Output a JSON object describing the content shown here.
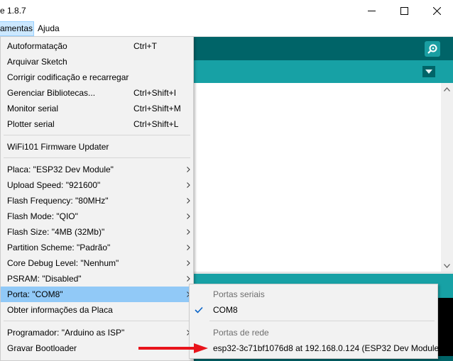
{
  "window": {
    "title": "e 1.8.7",
    "controls": [
      "minimize-icon",
      "maximize-icon",
      "close-icon"
    ]
  },
  "menubar": {
    "items": [
      {
        "label": "amentas",
        "active": true
      },
      {
        "label": "Ajuda",
        "active": false
      }
    ]
  },
  "tools_menu": {
    "items": [
      {
        "label": "Autoformatação",
        "shortcut": "Ctrl+T"
      },
      {
        "label": "Arquivar Sketch",
        "shortcut": ""
      },
      {
        "label": "Corrigir codificação e recarregar",
        "shortcut": ""
      },
      {
        "label": "Gerenciar Bibliotecas...",
        "shortcut": "Ctrl+Shift+I"
      },
      {
        "label": "Monitor serial",
        "shortcut": "Ctrl+Shift+M"
      },
      {
        "label": "Plotter serial",
        "shortcut": "Ctrl+Shift+L"
      },
      {
        "label": "WiFi101 Firmware Updater",
        "shortcut": ""
      },
      {
        "label": "Placa: \"ESP32 Dev Module\"",
        "submenu": true
      },
      {
        "label": "Upload Speed: \"921600\"",
        "submenu": true
      },
      {
        "label": "Flash Frequency: \"80MHz\"",
        "submenu": true
      },
      {
        "label": "Flash Mode: \"QIO\"",
        "submenu": true
      },
      {
        "label": "Flash Size: \"4MB (32Mb)\"",
        "submenu": true
      },
      {
        "label": "Partition Scheme: \"Padrão\"",
        "submenu": true
      },
      {
        "label": "Core Debug Level: \"Nenhum\"",
        "submenu": true
      },
      {
        "label": "PSRAM: \"Disabled\"",
        "submenu": true
      },
      {
        "label": "Porta: \"COM8\"",
        "submenu": true,
        "highlighted": true
      },
      {
        "label": "Obter informações da Placa",
        "shortcut": ""
      },
      {
        "label": "Programador: \"Arduino as ISP\"",
        "submenu": true
      },
      {
        "label": "Gravar Bootloader",
        "shortcut": ""
      }
    ]
  },
  "port_submenu": {
    "serial_header": "Portas seriais",
    "serial_ports": [
      {
        "label": "COM8",
        "checked": true
      }
    ],
    "network_header": "Portas de rede",
    "network_ports": [
      {
        "label": "esp32-3c71bf1076d8 at 192.168.0.124 (ESP32 Dev Module)"
      }
    ]
  },
  "colors": {
    "toolbar": "#006468",
    "tabs": "#17a1a5",
    "menu_bg": "#f2f2f2",
    "highlight": "#91c9f7",
    "annotation_arrow": "#e8141b"
  }
}
